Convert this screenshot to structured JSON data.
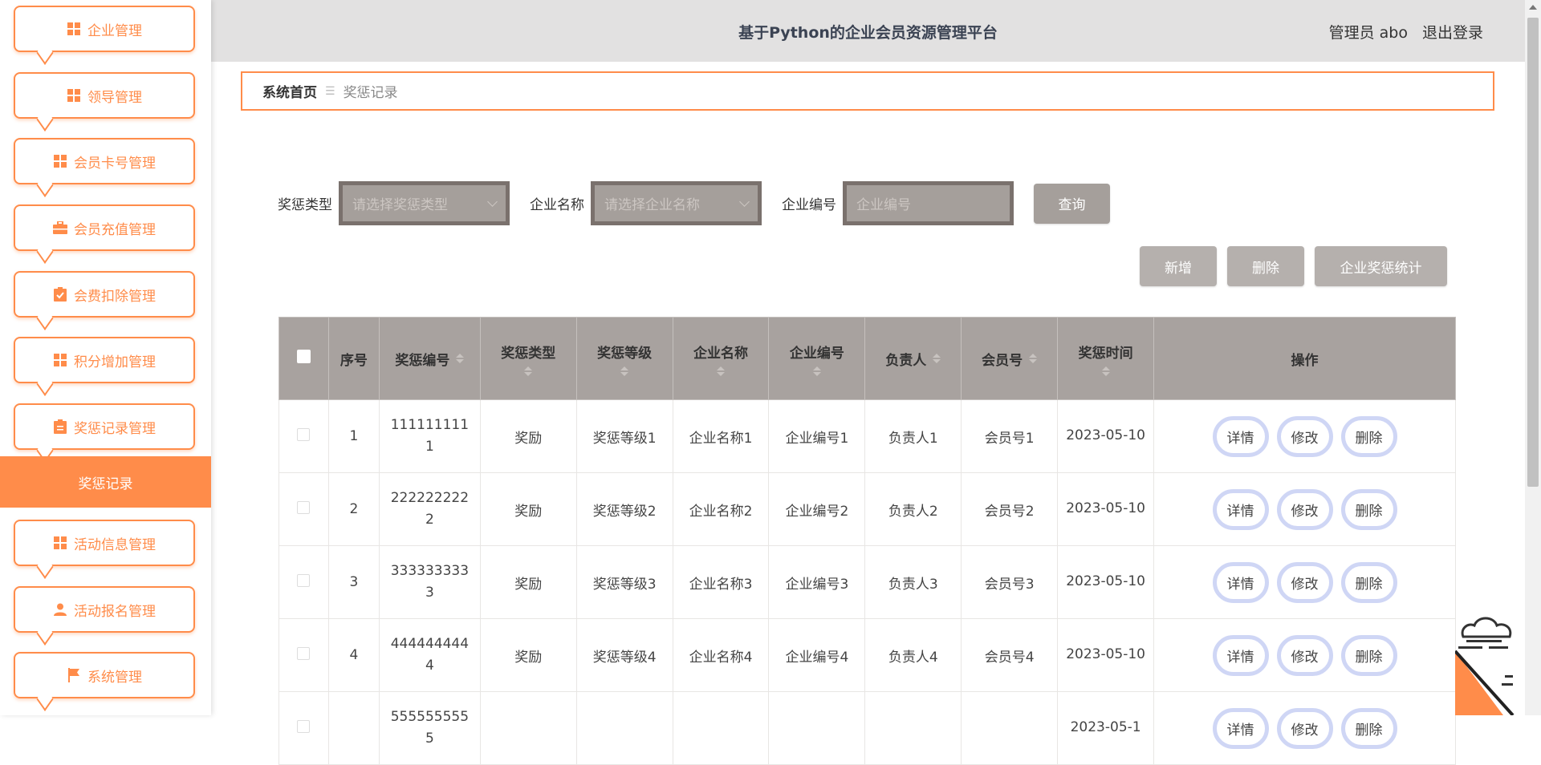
{
  "sidebar": {
    "menu": [
      {
        "label": "企业管理",
        "icon": "grid-icon"
      },
      {
        "label": "领导管理",
        "icon": "grid-icon"
      },
      {
        "label": "会员卡号管理",
        "icon": "grid-icon"
      },
      {
        "label": "会员充值管理",
        "icon": "briefcase-icon"
      },
      {
        "label": "会费扣除管理",
        "icon": "clipboard-check-icon"
      },
      {
        "label": "积分增加管理",
        "icon": "grid-icon"
      },
      {
        "label": "奖惩记录管理",
        "icon": "clipboard-icon"
      },
      {
        "label": "活动信息管理",
        "icon": "grid-icon"
      },
      {
        "label": "活动报名管理",
        "icon": "user-icon"
      },
      {
        "label": "系统管理",
        "icon": "flag-icon"
      }
    ],
    "active_submenu": "奖惩记录"
  },
  "header": {
    "title": "基于Python的企业会员资源管理平台",
    "user": "管理员 abo",
    "logout": "退出登录"
  },
  "breadcrumb": {
    "home": "系统首页",
    "separator": "☰",
    "current": "奖惩记录"
  },
  "search": {
    "type_label": "奖惩类型",
    "type_placeholder": "请选择奖惩类型",
    "company_label": "企业名称",
    "company_placeholder": "请选择企业名称",
    "code_label": "企业编号",
    "code_placeholder": "企业编号",
    "query_button": "查询"
  },
  "actions": {
    "add": "新增",
    "delete": "删除",
    "stats": "企业奖惩统计"
  },
  "table": {
    "columns": [
      "序号",
      "奖惩编号",
      "奖惩类型",
      "奖惩等级",
      "企业名称",
      "企业编号",
      "负责人",
      "会员号",
      "奖惩时间",
      "操作"
    ],
    "rows": [
      {
        "no": "1",
        "code": "1111111111",
        "type": "奖励",
        "level": "奖惩等级1",
        "company": "企业名称1",
        "company_code": "企业编号1",
        "owner": "负责人1",
        "member": "会员号1",
        "time": "2023-05-10"
      },
      {
        "no": "2",
        "code": "2222222222",
        "type": "奖励",
        "level": "奖惩等级2",
        "company": "企业名称2",
        "company_code": "企业编号2",
        "owner": "负责人2",
        "member": "会员号2",
        "time": "2023-05-10"
      },
      {
        "no": "3",
        "code": "3333333333",
        "type": "奖励",
        "level": "奖惩等级3",
        "company": "企业名称3",
        "company_code": "企业编号3",
        "owner": "负责人3",
        "member": "会员号3",
        "time": "2023-05-10"
      },
      {
        "no": "4",
        "code": "4444444444",
        "type": "奖励",
        "level": "奖惩等级4",
        "company": "企业名称4",
        "company_code": "企业编号4",
        "owner": "负责人4",
        "member": "会员号4",
        "time": "2023-05-10"
      },
      {
        "no": "",
        "code": "5555555555",
        "type": "",
        "level": "",
        "company": "",
        "company_code": "",
        "owner": "",
        "member": "",
        "time": "2023-05-1"
      }
    ],
    "op_detail": "详情",
    "op_edit": "修改",
    "op_delete": "删除"
  },
  "colors": {
    "accent": "#ff8c4a",
    "header_bg": "#e2e1e1",
    "table_head": "#a8a29f",
    "op_border": "#cfd6f5"
  }
}
